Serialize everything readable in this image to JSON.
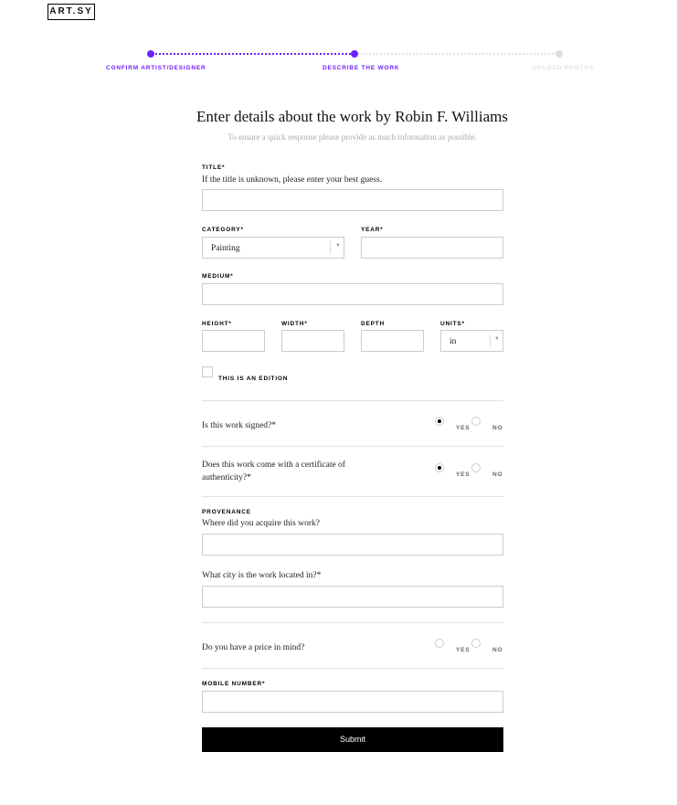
{
  "brand": {
    "logo_text": "ART.SY"
  },
  "progress": {
    "steps": [
      {
        "label": "CONFIRM ARTIST/DESIGNER",
        "state": "done"
      },
      {
        "label": "DESCRIBE THE WORK",
        "state": "current"
      },
      {
        "label": "UPLOAD PHOTOS",
        "state": "upcoming"
      }
    ],
    "accent": "#6e1fff",
    "upcoming_color": "#dddddd"
  },
  "header": {
    "title": "Enter details about the work by Robin F. Williams",
    "subtitle": "To ensure a quick response please provide as much information as possible."
  },
  "form": {
    "title_label": "TITLE*",
    "title_help": "If the title is unknown, please enter your best guess.",
    "title_value": "",
    "category_label": "CATEGORY*",
    "category_value": "Painting",
    "year_label": "YEAR*",
    "year_value": "",
    "medium_label": "MEDIUM*",
    "medium_value": "",
    "height_label": "HEIGHT*",
    "width_label": "WIDTH*",
    "depth_label": "DEPTH",
    "units_label": "UNITS*",
    "units_value": "in",
    "edition_label": "THIS IS AN EDITION",
    "signed_question": "Is this work signed?*",
    "certificate_question": "Does this work come with a certificate of authenticity?*",
    "yes_label": "YES",
    "no_label": "NO",
    "signed_selection": "yes",
    "certificate_selection": "yes",
    "provenance_label": "PROVENANCE",
    "provenance_help": "Where did you acquire this work?",
    "city_help": "What city is the work located in?*",
    "price_question": "Do you have a price in mind?",
    "mobile_label": "MOBILE NUMBER*",
    "submit_label": "Submit"
  }
}
